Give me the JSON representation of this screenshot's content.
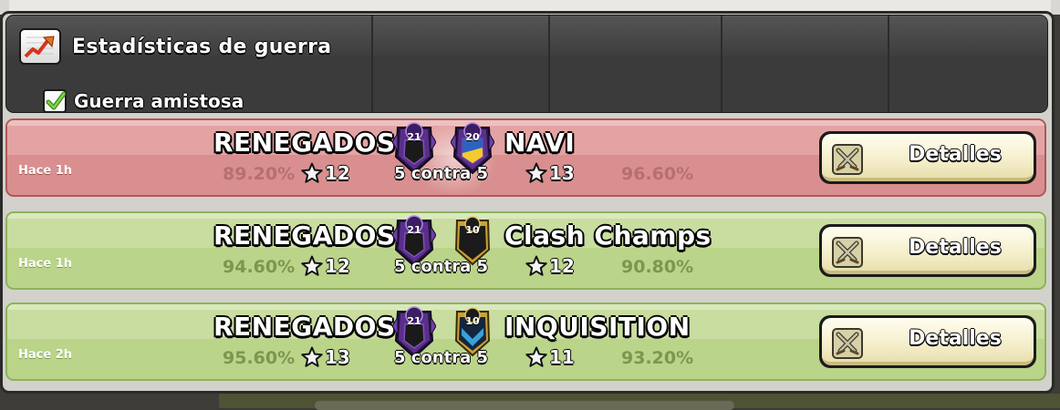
{
  "header": {
    "title": "Estadísticas de guerra",
    "friendly_label": "Guerra amistosa",
    "friendly_checked": true
  },
  "wars": [
    {
      "result": "loss",
      "time": "Hace 1h",
      "clan_left": "RENEGADOS",
      "clan_right": "NAVI",
      "badge_left_level": "21",
      "badge_right_level": "20",
      "pct_left": "89.20%",
      "stars_left": "12",
      "vs_label": "5 contra 5",
      "stars_right": "13",
      "pct_right": "96.60%",
      "details_label": "Detalles"
    },
    {
      "result": "win",
      "time": "Hace 1h",
      "clan_left": "RENEGADOS",
      "clan_right": "Clash Champs",
      "badge_left_level": "21",
      "badge_right_level": "10",
      "pct_left": "94.60%",
      "stars_left": "12",
      "vs_label": "5 contra 5",
      "stars_right": "12",
      "pct_right": "90.80%",
      "details_label": "Detalles"
    },
    {
      "result": "win",
      "time": "Hace 2h",
      "clan_left": "RENEGADOS",
      "clan_right": "INQUISITION",
      "badge_left_level": "21",
      "badge_right_level": "10",
      "pct_left": "95.60%",
      "stars_left": "13",
      "vs_label": "5 contra 5",
      "stars_right": "11",
      "pct_right": "93.20%",
      "details_label": "Detalles"
    }
  ],
  "colors": {
    "loss_row": "#d98f8f",
    "win_row": "#bad489",
    "header_bg": "#3b3b3b",
    "button_face": "#f6f0cf",
    "badge_purple": "#4b2a78"
  },
  "icons": {
    "stats": "line-chart-up-icon",
    "checkbox": "checkmark-icon",
    "star": "star-icon",
    "swords": "crossed-swords-icon"
  }
}
